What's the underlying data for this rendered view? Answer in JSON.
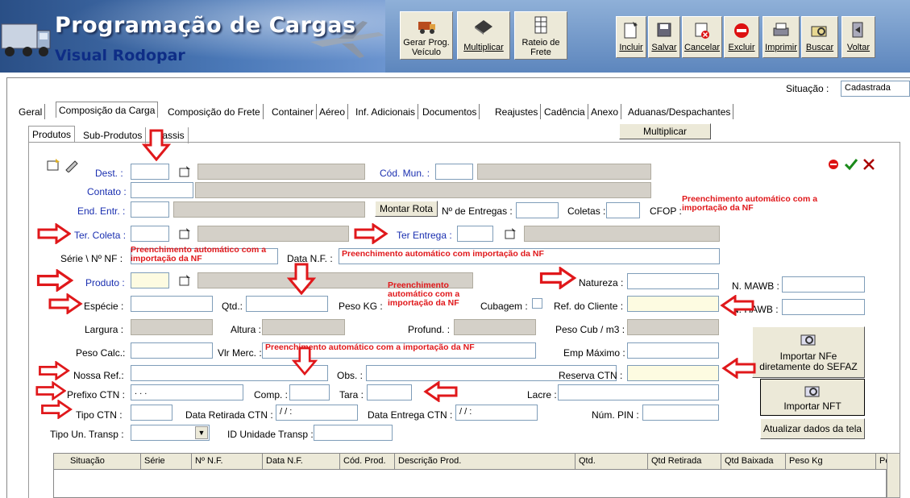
{
  "header": {
    "title": "Programação de Cargas",
    "subtitle": "Visual Rodopar"
  },
  "toolbar": {
    "gerar": {
      "line1": "Gerar Prog.",
      "line2": "Veículo"
    },
    "multiplicar": "Multiplicar",
    "rateio": {
      "line1": "Rateio de",
      "line2": "Frete"
    },
    "incluir": "Incluir",
    "salvar": "Salvar",
    "cancelar": "Cancelar",
    "excluir": "Excluir",
    "imprimir": "Imprimir",
    "buscar": "Buscar",
    "voltar": "Voltar"
  },
  "status": {
    "label": "Situação :",
    "value": "Cadastrada"
  },
  "tabs": [
    "Geral",
    "Composição da Carga",
    "Composição do Frete",
    "Container",
    "Aéreo",
    "Inf. Adicionais",
    "Documentos",
    "Reajustes",
    "Cadência",
    "Anexo",
    "Aduanas/Despachantes"
  ],
  "subtabs": [
    "Produtos",
    "Sub-Produtos",
    "Chassis"
  ],
  "multiplicar_button": "Multiplicar",
  "form": {
    "dest": "Dest. :",
    "cod_mun": "Cód. Mun. :",
    "contato": "Contato :",
    "end_entr": "End. Entr. :",
    "montar_rota": "Montar Rota",
    "n_entregas": "Nº de Entregas :",
    "coletas": "Coletas :",
    "cfop": "CFOP :",
    "ter_coleta": "Ter. Coleta :",
    "ter_entrega": "Ter Entrega :",
    "serie_nf": "Série \\ Nº NF :",
    "data_nf": "Data N.F. :",
    "produto": "Produto :",
    "natureza": "Natureza :",
    "n_mawb": "N. MAWB :",
    "especie": "Espécie :",
    "qtd": "Qtd.:",
    "peso_kg": "Peso KG :",
    "cubagem": "Cubagem :",
    "ref_cliente": "Ref. do Cliente :",
    "n_hawb": "N. HAWB :",
    "largura": "Largura :",
    "altura": "Altura :",
    "profund": "Profund. :",
    "peso_cub": "Peso Cub / m3 :",
    "peso_calc": "Peso Calc.:",
    "vlr_merc": "Vlr Merc. :",
    "emp_maximo": "Emp Máximo :",
    "nossa_ref": "Nossa Ref.:",
    "obs": "Obs. :",
    "reserva_ctn": "Reserva CTN :",
    "prefixo_ctn": "Prefixo CTN :",
    "prefixo_value": " .  .  .",
    "comp": "Comp. :",
    "tara": "Tara :",
    "lacre": "Lacre :",
    "tipo_ctn": "Tipo CTN :",
    "data_retirada": "Data Retirada CTN :",
    "data_retirada_value": " / /     :",
    "data_entrega": "Data Entrega CTN :",
    "data_entrega_value": " / /     :",
    "num_pin": "Núm. PIN :",
    "tipo_un": "Tipo Un. Transp :",
    "id_unidade": "ID Unidade Transp :"
  },
  "side_buttons": {
    "importar_nfe": {
      "line1": "Importar NFe",
      "line2": "diretamente do SEFAZ"
    },
    "importar_nft": "Importar NFT",
    "atualizar": "Atualizar dados da tela"
  },
  "notes": {
    "cfop_note": {
      "line1": "Preenchimento  automático com a",
      "line2": "importação da NF"
    },
    "serie_note": {
      "line1": "Preenchimento automático com a",
      "line2": "importação da NF"
    },
    "data_note": "Preenchimento automático com importação da NF",
    "peso_note": {
      "line1": "Preenchimento",
      "line2": "automático com a",
      "line3": "importação da NF"
    },
    "vlr_note": "Preenchimento automático com a importação da NF"
  },
  "grid_columns": [
    "Situação",
    "Série",
    "Nº N.F.",
    "Data N.F.",
    "Cód. Prod.",
    "Descrição Prod.",
    "Qtd.",
    "Qtd Retirada",
    "Qtd Baixada",
    "Peso Kg",
    "Pes"
  ],
  "colors": {
    "note_red": "#e0181b",
    "label_blue": "#1a2fb0",
    "yellow_field": "#fdfbe1"
  }
}
